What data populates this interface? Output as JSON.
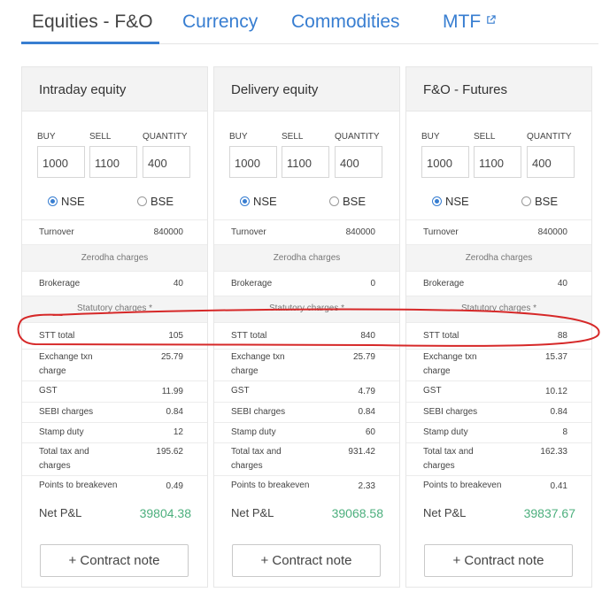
{
  "tabs": [
    {
      "label": "Equities - F&O",
      "active": true
    },
    {
      "label": "Currency",
      "active": false
    },
    {
      "label": "Commodities",
      "active": false
    },
    {
      "label": "MTF",
      "active": false,
      "icon": "external-link-icon"
    }
  ],
  "labels": {
    "buy": "BUY",
    "sell": "SELL",
    "quantity": "QUANTITY",
    "nse": "NSE",
    "bse": "BSE",
    "turnover": "Turnover",
    "zerodha_charges": "Zerodha charges",
    "brokerage": "Brokerage",
    "statutory_charges": "Statutory charges *",
    "stt_total": "STT total",
    "exchange_txn_charge": "Exchange txn charge",
    "gst": "GST",
    "sebi_charges": "SEBI charges",
    "stamp_duty": "Stamp duty",
    "total_tax_and_charges": "Total tax and charges",
    "points_to_breakeven": "Points to breakeven",
    "net_pnl": "Net P&L",
    "contract_note": "+ Contract note"
  },
  "colors": {
    "accent": "#387ed1",
    "profit": "#4caf7d",
    "annotation": "#d62828"
  },
  "cards": [
    {
      "title": "Intraday equity",
      "buy": "1000",
      "sell": "1100",
      "quantity": "400",
      "exchange_selected": "NSE",
      "turnover": "840000",
      "brokerage": "40",
      "stt_total": "105",
      "exchange_txn_charge": "25.79",
      "gst": "11.99",
      "sebi_charges": "0.84",
      "stamp_duty": "12",
      "total_tax_and_charges": "195.62",
      "points_to_breakeven": "0.49",
      "net_pnl": "39804.38"
    },
    {
      "title": "Delivery equity",
      "buy": "1000",
      "sell": "1100",
      "quantity": "400",
      "exchange_selected": "NSE",
      "turnover": "840000",
      "brokerage": "0",
      "stt_total": "840",
      "exchange_txn_charge": "25.79",
      "gst": "4.79",
      "sebi_charges": "0.84",
      "stamp_duty": "60",
      "total_tax_and_charges": "931.42",
      "points_to_breakeven": "2.33",
      "net_pnl": "39068.58"
    },
    {
      "title": "F&O - Futures",
      "buy": "1000",
      "sell": "1100",
      "quantity": "400",
      "exchange_selected": "NSE",
      "turnover": "840000",
      "brokerage": "40",
      "stt_total": "88",
      "exchange_txn_charge": "15.37",
      "gst": "10.12",
      "sebi_charges": "0.84",
      "stamp_duty": "8",
      "total_tax_and_charges": "162.33",
      "points_to_breakeven": "0.41",
      "net_pnl": "39837.67"
    }
  ]
}
